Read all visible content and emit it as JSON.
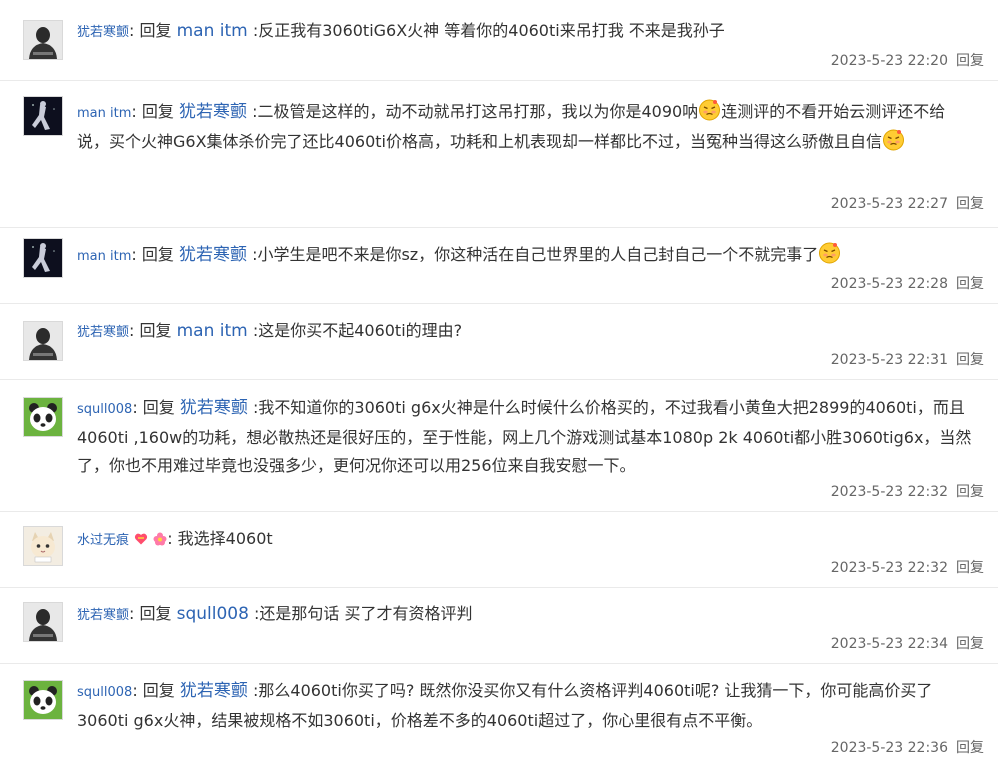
{
  "reply_word": "回复",
  "reply_link": "回复",
  "replies": [
    {
      "user": "犹若寒颤",
      "target": "man itm",
      "text": ":反正我有3060tiG6X火神 等着你的4060ti来吊打我 不来是我孙子",
      "time": "2023-5-23 22:20"
    },
    {
      "user": "man itm",
      "target": "犹若寒颤",
      "text_a": ":二极管是这样的，动不动就吊打这吊打那，我以为你是4090呐",
      "text_b": "连测评的不看开始云测评还不给说，买个火神G6X集体杀价完了还比4060ti价格高，功耗和上机表现却一样都比不过，当冤种当得这么骄傲且自信",
      "time": "2023-5-23 22:27"
    },
    {
      "user": "man itm",
      "target": "犹若寒颤",
      "text": ":小学生是吧不来是你sz，你这种活在自己世界里的人自己封自己一个不就完事了",
      "time": "2023-5-23 22:28"
    },
    {
      "user": "犹若寒颤",
      "target": "man itm",
      "text": ":这是你买不起4060ti的理由?",
      "time": "2023-5-23 22:31"
    },
    {
      "user": "squll008",
      "target": "犹若寒颤",
      "text": ":我不知道你的3060ti g6x火神是什么时候什么价格买的，不过我看小黄鱼大把2899的4060ti，而且4060ti ,160w的功耗，想必散热还是很好压的，至于性能，网上几个游戏测试基本1080p 2k 4060ti都小胜3060tig6x，当然了，你也不用难过毕竟也没强多少，更何况你还可以用256位来自我安慰一下。",
      "time": "2023-5-23 22:32"
    },
    {
      "user": "水过无痕",
      "text": ": 我选择4060t",
      "time": "2023-5-23 22:32"
    },
    {
      "user": "犹若寒颤",
      "target": "squll008",
      "text": ":还是那句话 买了才有资格评判",
      "time": "2023-5-23 22:34"
    },
    {
      "user": "squll008",
      "target": "犹若寒颤",
      "text": ":那么4060ti你买了吗? 既然你没买你又有什么资格评判4060ti呢? 让我猜一下，你可能高价买了3060ti g6x火神，结果被规格不如3060ti，价格差不多的4060ti超过了，你心里很有点不平衡。",
      "time": "2023-5-23 22:36"
    }
  ]
}
